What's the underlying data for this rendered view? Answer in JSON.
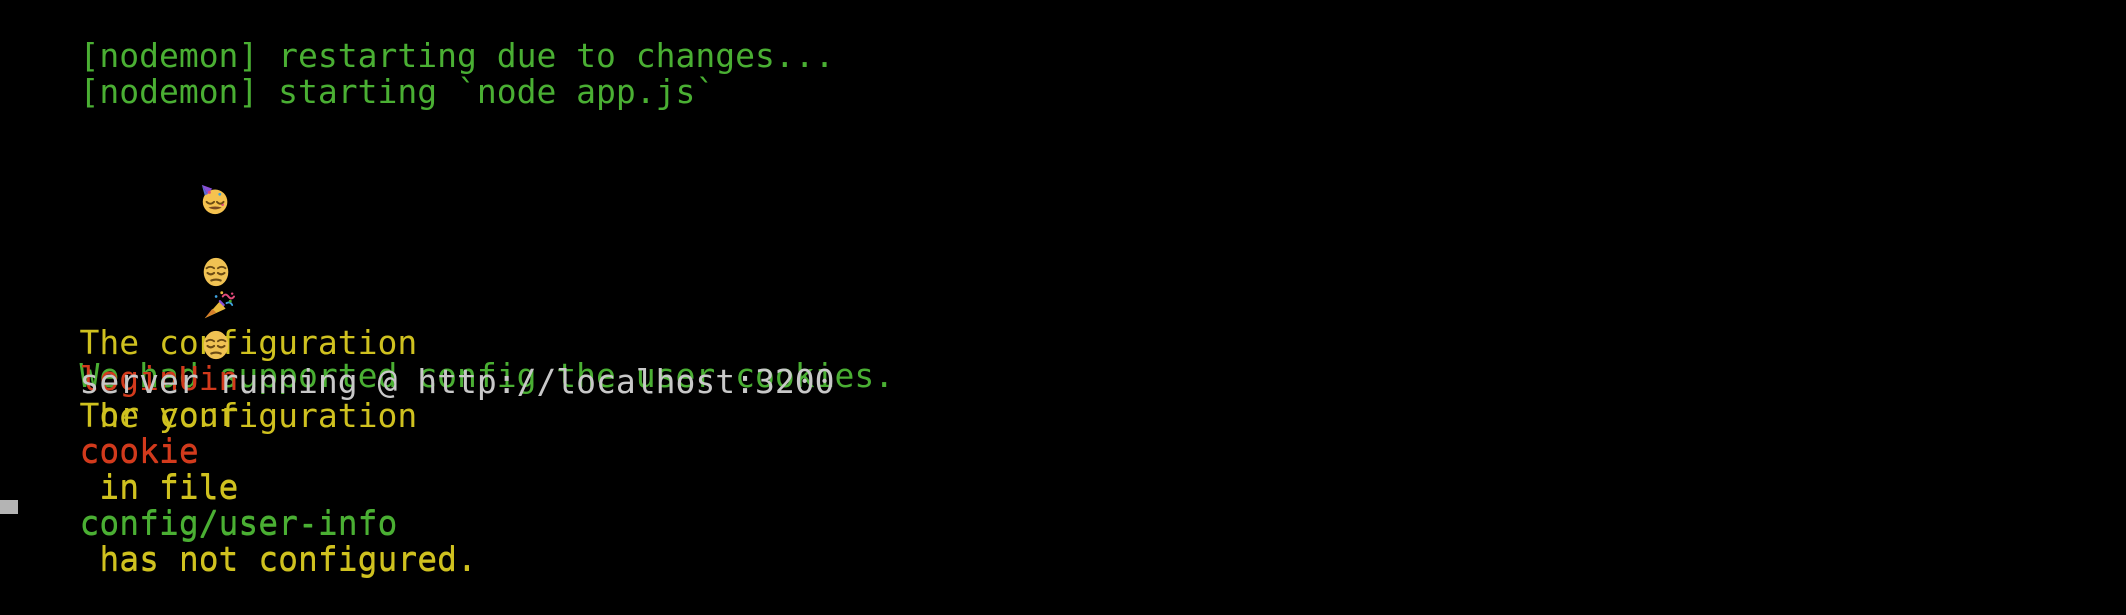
{
  "terminal": {
    "background_color": "#000000",
    "colors": {
      "green": "#4aaf33",
      "yellow": "#cfc11f",
      "red": "#d23a1c",
      "white": "#c8c8c8",
      "cursor": "#b4b4b4"
    },
    "lines": [
      {
        "id": "nodemon-restart",
        "name": "nodemon-restart-line",
        "text": "[nodemon] restarting due to changes...",
        "color": "green"
      },
      {
        "id": "nodemon-start",
        "name": "nodemon-start-line",
        "text": "[nodemon] starting `node app.js`",
        "color": "green"
      },
      {
        "id": "celebrate",
        "name": "config-success-line",
        "emoji": [
          "partying-face",
          "party-popper"
        ],
        "text": "We had supported config the user cookies.",
        "color": "green"
      },
      {
        "id": "warn-login",
        "name": "warning-loginuin-line",
        "emoji": [
          "pensive-face"
        ],
        "color": "yellow",
        "segments": [
          {
            "text": "The configuration ",
            "color": "yellow"
          },
          {
            "text": "loginUin",
            "color": "red"
          },
          {
            "text": " or your ",
            "color": "yellow"
          },
          {
            "text": "cookie",
            "color": "red"
          },
          {
            "text": " in file ",
            "color": "yellow"
          },
          {
            "text": "config/user-info",
            "color": "green"
          },
          {
            "text": " has not configured.",
            "color": "yellow"
          }
        ]
      },
      {
        "id": "warn-cookie",
        "name": "warning-cookie-line",
        "emoji": [
          "pensive-face"
        ],
        "color": "yellow",
        "segments": [
          {
            "text": "The configuration ",
            "color": "yellow"
          },
          {
            "text": "cookie",
            "color": "red"
          },
          {
            "text": " in file ",
            "color": "yellow"
          },
          {
            "text": "config/user-info",
            "color": "green"
          },
          {
            "text": " has not configured.",
            "color": "yellow"
          }
        ]
      },
      {
        "id": "server",
        "name": "server-running-line",
        "text": "server running @ http://localhost:3200",
        "color": "white"
      }
    ],
    "cursor": {
      "visible": true,
      "shape": "block"
    }
  },
  "line1": {
    "text": "[nodemon] restarting due to changes..."
  },
  "line2": {
    "text": "[nodemon] starting `node app.js`"
  },
  "line3": {
    "text": "We had supported config the user cookies."
  },
  "line4": {
    "s1": "The configuration ",
    "s2": "loginUin",
    "s3": " or your ",
    "s4": "cookie",
    "s5": " in file ",
    "s6": "config/user-info",
    "s7": " has not configured."
  },
  "line5": {
    "s1": "The configuration ",
    "s2": "cookie",
    "s3": " in file ",
    "s4": "config/user-info",
    "s5": " has not configured."
  },
  "line6": {
    "text": "server running @ http://localhost:3200"
  }
}
